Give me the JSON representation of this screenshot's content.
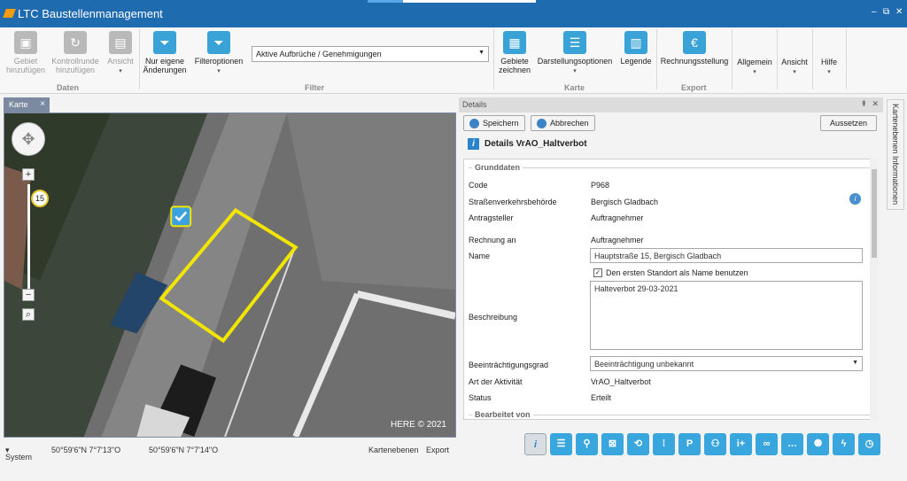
{
  "window": {
    "title": "LTC Baustellenmanagement",
    "minimize": "–",
    "restore": "⧉",
    "close": "✕"
  },
  "ribbon": {
    "daten": {
      "label": "Daten",
      "gebiet": "Gebiet hinzufügen",
      "kontrollrunde": "Kontrollrunde hinzufügen",
      "ansicht": "Ansicht"
    },
    "filter": {
      "label": "Filter",
      "nur_eigene": "Nur eigene Änderungen",
      "filteroptionen": "Filteroptionen",
      "combo_value": "Aktive Aufbrüche / Genehmigungen"
    },
    "karte": {
      "label": "Karte",
      "gebiete_zeichnen": "Gebiete zeichnen",
      "darstellungsoptionen": "Darstellungsoptionen",
      "legende": "Legende"
    },
    "export": {
      "label": "Export",
      "rechnungsstellung": "Rechnungsstellung"
    },
    "allgemein": "Allgemein",
    "ansicht": "Ansicht",
    "hilfe": "Hilfe"
  },
  "map": {
    "tab_label": "Karte",
    "zoom_level": "15",
    "copyright": "HERE © 2021"
  },
  "statusbar": {
    "system": "System",
    "coord1": "50°59'6\"N 7°7'13\"O",
    "coord2": "50°59'6\"N 7°7'14\"O",
    "kartenebenen": "Kartenebenen",
    "export": "Export"
  },
  "details": {
    "header": "Details",
    "save": "Speichern",
    "cancel": "Abbrechen",
    "pause": "Aussetzen",
    "title": "Details VrAO_Haltverbot",
    "group_grunddaten": "Grunddaten",
    "group_bearbeitet": "Bearbeitet von",
    "fields": {
      "code_label": "Code",
      "code_value": "P968",
      "behoerde_label": "Straßenverkehrsbehörde",
      "behoerde_value": "Bergisch Gladbach",
      "antragsteller_label": "Antragsteller",
      "antragsteller_value": "Auftragnehmer",
      "rechnung_label": "Rechnung an",
      "rechnung_value": "Auftragnehmer",
      "name_label": "Name",
      "name_value": "Hauptstraße 15, Bergisch Gladbach",
      "checkbox_label": "Den ersten Standort als Name benutzen",
      "beschreibung_label": "Beschreibung",
      "beschreibung_value": "Halteverbot 29-03-2021",
      "grad_label": "Beeinträchtigungsgrad",
      "grad_value": "Beeinträchtigung unbekannt",
      "art_label": "Art der Aktivität",
      "art_value": "VrAO_Haltverbot",
      "status_label": "Status",
      "status_value": "Erteilt"
    }
  },
  "sidepanel": {
    "label": "Kartenebenen Informationen"
  },
  "colors": {
    "titlebar": "#1f6bb0",
    "accent": "#39a3d8",
    "polygon": "#f2e600"
  }
}
